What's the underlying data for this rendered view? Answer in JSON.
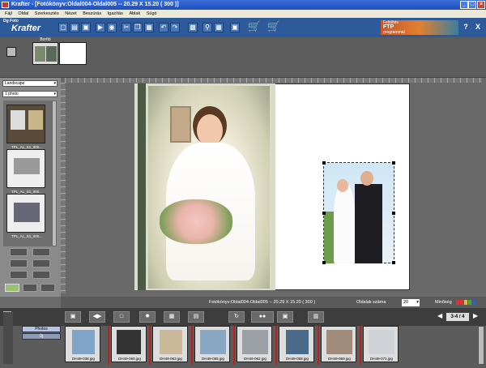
{
  "window": {
    "title": "Krafter - [Fotókönyv:Oldal004-Oldal005 -- 20.29 X 15.20 ( 300 )]"
  },
  "menu": [
    "Fájl",
    "Oldal",
    "Szerkesztés",
    "Nézet",
    "Beszúrás",
    "Igazítás",
    "Ablak",
    "Súgó"
  ],
  "toolbar": {
    "logo_top": "Dg Foto",
    "logo_brand": "Krafter",
    "ftp_banner": [
      "Feltöltés",
      "FTP",
      "programmal"
    ],
    "help": "?",
    "close": "X"
  },
  "page_strip": {
    "label": "Borító"
  },
  "left_panel": {
    "layout_select": "Landscape",
    "photo_select": "1 photo",
    "thumbs": [
      "TPL_AL_S1_000...",
      "TPL_AL_S1_000...",
      "TPL_AL_S1_000..."
    ]
  },
  "status": {
    "title": "Fotókönyv:Oldal004-Oldal005 -- 20.29 X 15.20 ( 300 )",
    "pages_label": "Oldalak száma",
    "pages_value": "20",
    "quality_label": "Minőség"
  },
  "bottom": {
    "tabs": [
      "Photos",
      "Új"
    ],
    "page_counter": "3-4 / 4",
    "photos": [
      "DH49-038.jpg",
      "DH49-060.jpg",
      "DH49-063.jpg",
      "DH49-065.jpg",
      "DH49-062.jpg",
      "DH49-068.jpg",
      "DH49-069.jpg",
      "DH49-071.jpg"
    ]
  },
  "colors": {
    "title_bg": "#1d4fbf",
    "toolbar_bg": "#2d5a9a",
    "accent_red": "#c01e1e"
  }
}
